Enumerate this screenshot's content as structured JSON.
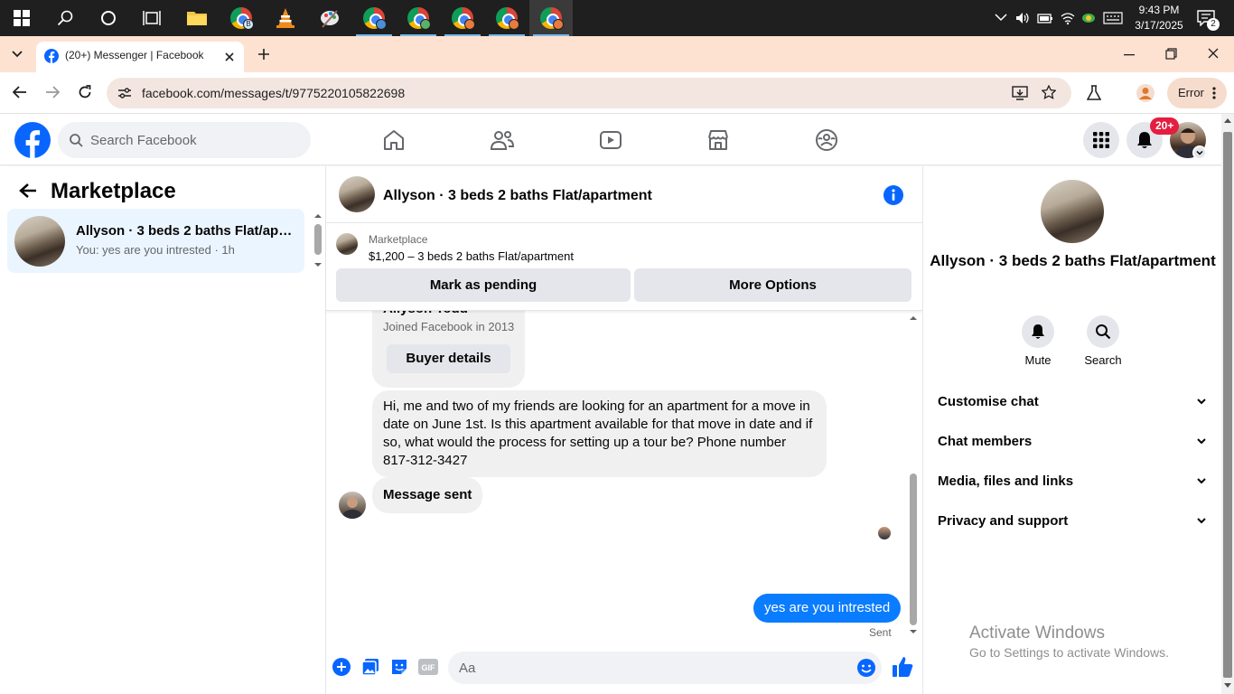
{
  "taskbar": {
    "time": "9:43 PM",
    "date": "3/17/2025",
    "notification_count": "2",
    "chrome_badge_letter": "B"
  },
  "browser": {
    "tab_title": "(20+) Messenger | Facebook",
    "url": "facebook.com/messages/t/9775220105822698",
    "error_label": "Error"
  },
  "fb_header": {
    "search_placeholder": "Search Facebook",
    "notifications_badge": "20+"
  },
  "left_panel": {
    "title": "Marketplace",
    "conversations": [
      {
        "name": "Allyson · 3 beds 2 baths Flat/apartment",
        "preview": "You: yes are you intrested · 1h"
      }
    ]
  },
  "chat": {
    "title": "Allyson · 3 beds 2 baths Flat/apartment",
    "marketplace_label": "Marketplace",
    "listing_price_title": "$1,200 – 3 beds 2 baths Flat/apartment",
    "mark_pending_label": "Mark as pending",
    "more_options_label": "More Options",
    "buyer_name_partial": "Allyson Todd",
    "buyer_joined": "Joined Facebook in 2013",
    "buyer_details_label": "Buyer details",
    "incoming_message": "Hi, me and two of my friends are looking for an apartment for a move in date on June 1st. Is this apartment available for that move in date and if so, what would the process for setting up a tour be? Phone number 817-312-3427",
    "system_message": "Message sent",
    "outgoing_message": "yes are you intrested",
    "outgoing_status": "Sent",
    "composer_placeholder": "Aa"
  },
  "right_panel": {
    "name": "Allyson · 3 beds 2 baths Flat/apartment",
    "actions": [
      {
        "label": "Mute",
        "icon": "bell-icon"
      },
      {
        "label": "Search",
        "icon": "search-icon"
      }
    ],
    "sections": [
      "Customise chat",
      "Chat members",
      "Media, files and links",
      "Privacy and support"
    ]
  },
  "watermark": {
    "line1": "Activate Windows",
    "line2": "Go to Settings to activate Windows."
  },
  "colors": {
    "messenger_blue": "#0a7cff",
    "facebook_blue": "#0866ff",
    "tab_strip": "#fde2d2",
    "badge_red": "#e41e3f"
  }
}
